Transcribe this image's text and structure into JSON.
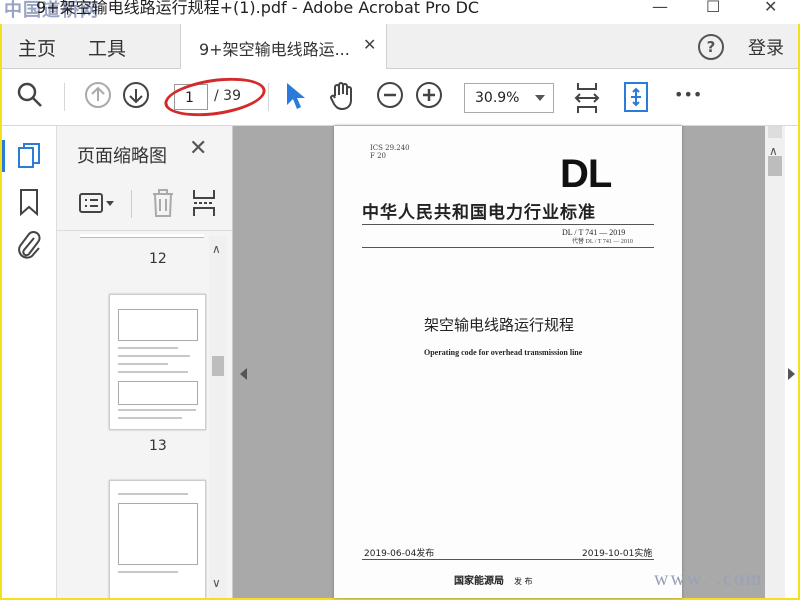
{
  "window": {
    "title": "9+架空输电线路运行规程+(1).pdf - Adobe Acrobat Pro DC",
    "watermark": "中国道桥网",
    "minimize_icon": "minimize-icon",
    "maximize_icon": "maximize-icon",
    "close_icon": "close-icon"
  },
  "menu": {
    "home": "主页",
    "tools": "工具",
    "doc_tab": "9+架空输电线路运...",
    "help": "?",
    "login": "登录"
  },
  "toolbar": {
    "page_current": "1",
    "page_total": "/ 39",
    "zoom": "30.9%",
    "more": "•••"
  },
  "sidebar": {
    "panel_title": "页面缩略图",
    "thumbnails": [
      {
        "page": "12"
      },
      {
        "page": "13"
      },
      {
        "page": ""
      }
    ]
  },
  "document": {
    "ics": "ICS 29.240",
    "f_code": "F 20",
    "logo": "DL",
    "standard_title": "中华人民共和国电力行业标准",
    "code": "DL / T  741 — 2019",
    "replaces": "代替 DL / T  741 — 2010",
    "title_cn": "架空输电线路运行规程",
    "title_en": "Operating code for overhead transmission line",
    "published": "2019-06-04发布",
    "effective": "2019-10-01实施",
    "issuer": "国家能源局",
    "issuer_suffix": "发 布"
  },
  "footer": {
    "watermark": "www.       .com"
  },
  "colors": {
    "accent": "#2b7bd9",
    "annotation": "#d42a2a",
    "frame": "#f2e21b"
  }
}
